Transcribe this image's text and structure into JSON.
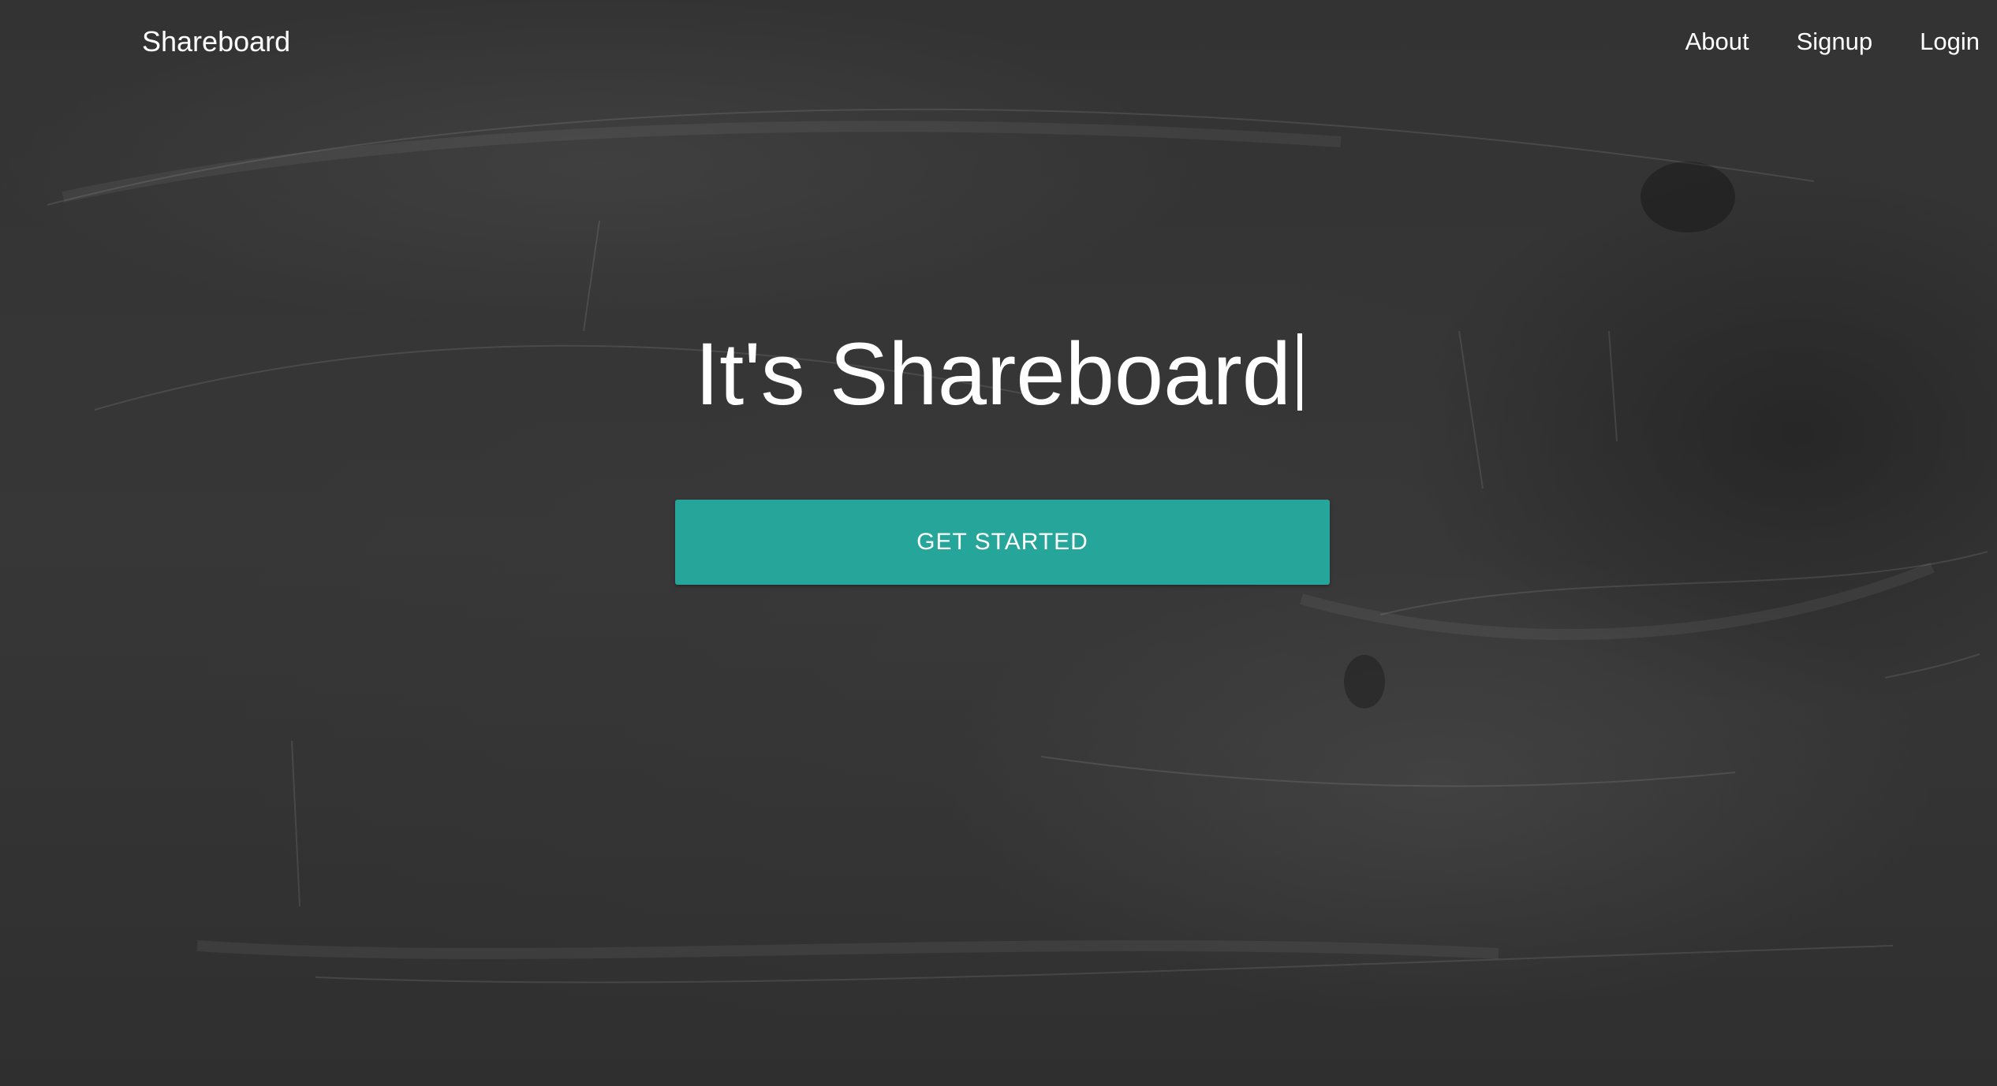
{
  "nav": {
    "brand": "Shareboard",
    "links": [
      {
        "label": "About"
      },
      {
        "label": "Signup"
      },
      {
        "label": "Login"
      }
    ]
  },
  "hero": {
    "title": "It's Shareboard",
    "cta_label": "GET STARTED"
  },
  "colors": {
    "accent": "#26a69a",
    "background": "#363636",
    "text": "#ffffff"
  }
}
